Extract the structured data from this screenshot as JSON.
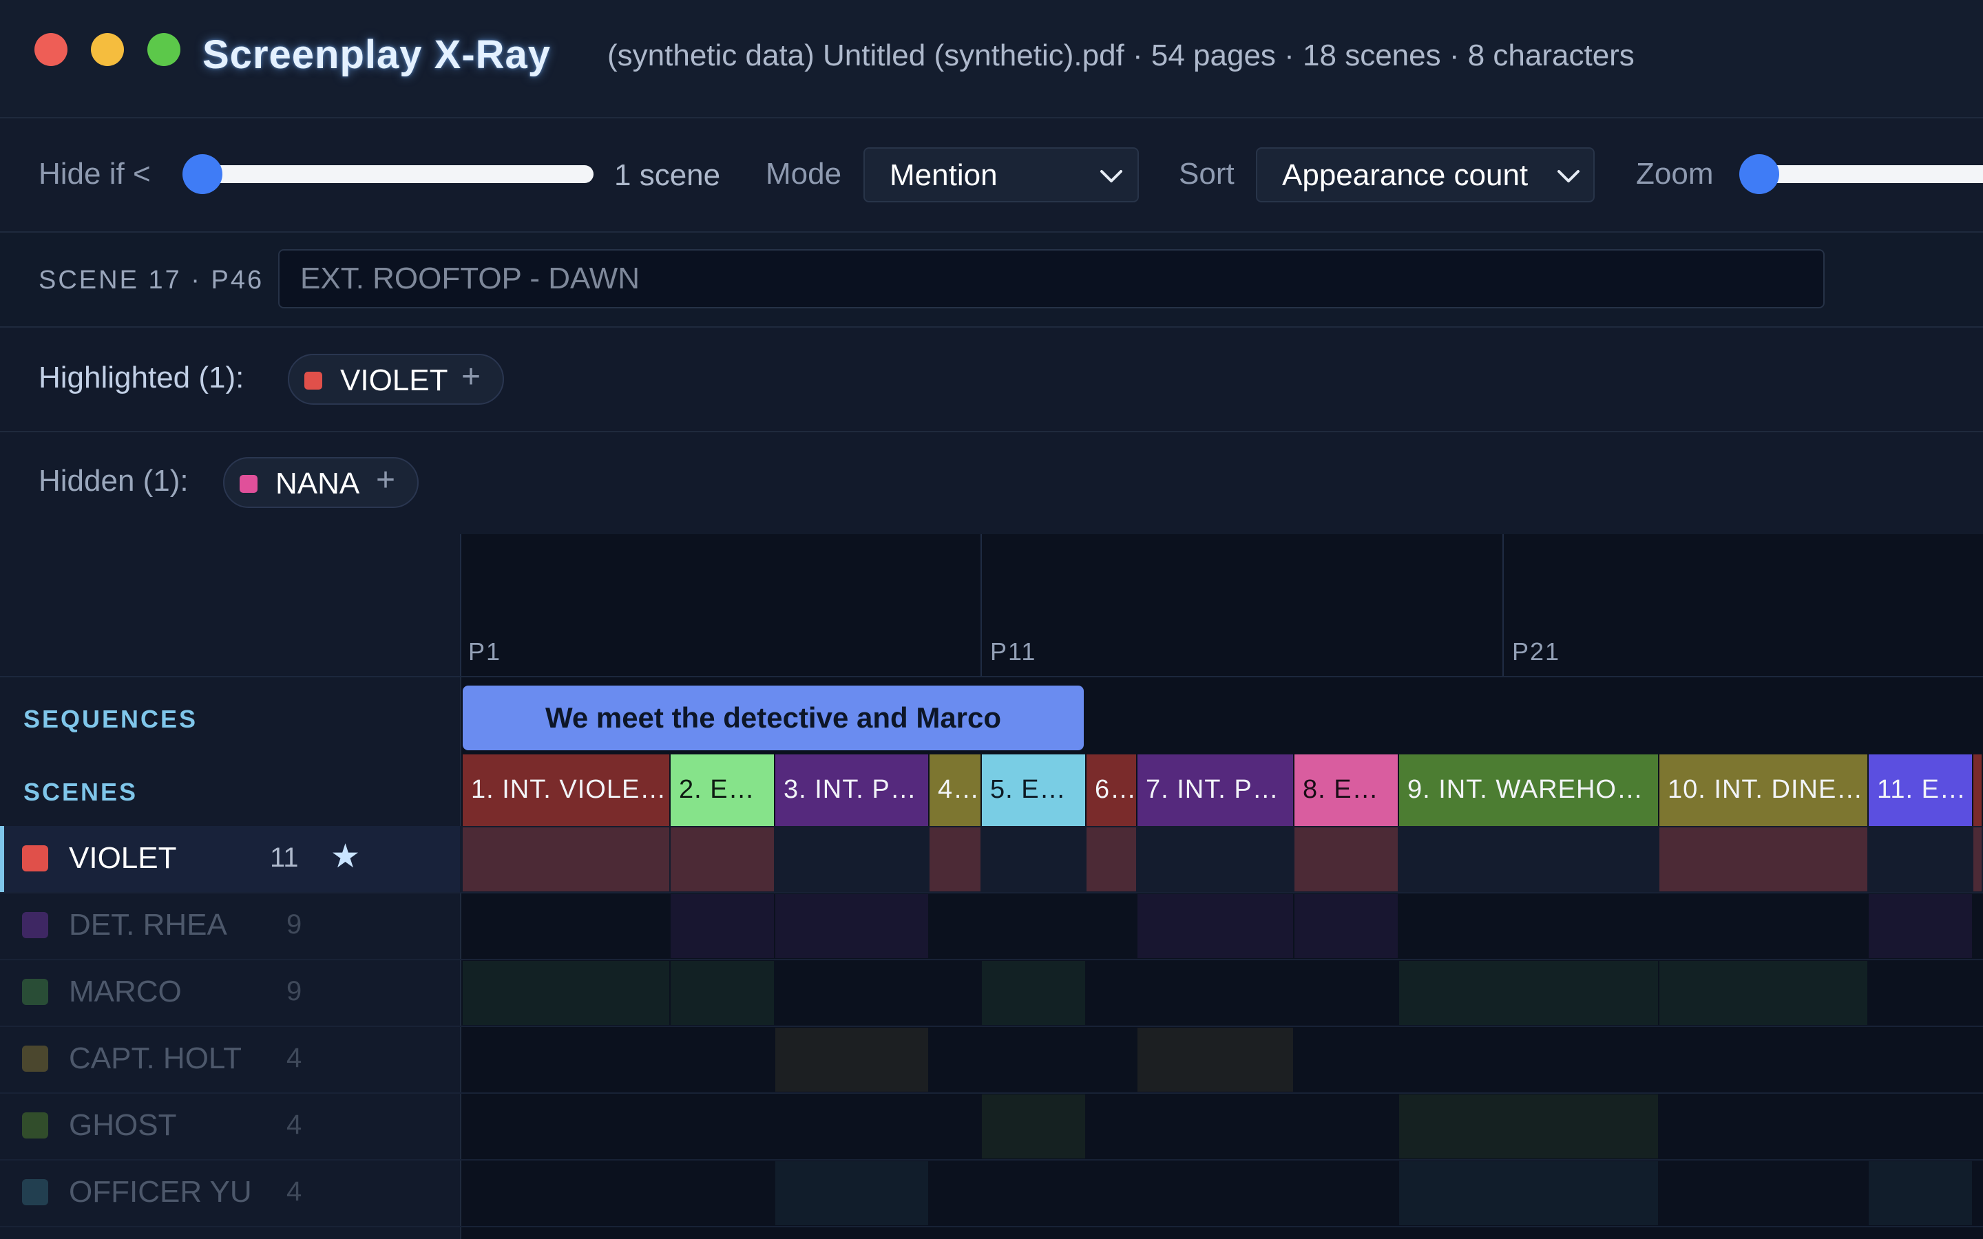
{
  "app": {
    "title": "Screenplay X-Ray",
    "doc_info": "(synthetic data) Untitled (synthetic).pdf · 54 pages · 18 scenes · 8 characters"
  },
  "controls": {
    "hide_label": "Hide if <",
    "hide_value": "1 scene",
    "hide_fraction": 0,
    "mode_label": "Mode",
    "mode_value": "Mention",
    "sort_label": "Sort",
    "sort_value": "Appearance count",
    "zoom_label": "Zoom"
  },
  "scene_bar": {
    "label": "SCENE 17 · P46",
    "placeholder": "EXT. ROOFTOP - DAWN"
  },
  "highlighted": {
    "label": "Highlighted (1):",
    "chips": [
      {
        "name": "VIOLET",
        "color": "#e0504a"
      }
    ]
  },
  "hidden": {
    "label": "Hidden (1):",
    "chips": [
      {
        "name": "NANA",
        "color": "#e0509a"
      }
    ]
  },
  "timeline": {
    "page_labels": [
      "P1",
      "P11",
      "P21"
    ],
    "sequences_label": "SEQUENCES",
    "scenes_label": "SCENES",
    "sequences": [
      {
        "label": "We meet the detective and Marco"
      }
    ],
    "scenes": [
      {
        "label": "1. INT. VIOLE…",
        "color": "#7a2b2b",
        "text_color": "#f2f4f8"
      },
      {
        "label": "2. E…",
        "color": "#86e38a",
        "text_color": "#0e1a12"
      },
      {
        "label": "3. INT. P…",
        "color": "#55297d",
        "text_color": "#f2f4f8"
      },
      {
        "label": "4…",
        "color": "#7d7630",
        "text_color": "#f2f4f8"
      },
      {
        "label": "5. E…",
        "color": "#79cde4",
        "text_color": "#0d1a24"
      },
      {
        "label": "6…",
        "color": "#7a2b2b",
        "text_color": "#f2f4f8"
      },
      {
        "label": "7. INT. P…",
        "color": "#55297d",
        "text_color": "#f2f4f8"
      },
      {
        "label": "8. E…",
        "color": "#d95d9f",
        "text_color": "#1a0d16"
      },
      {
        "label": "9. INT. WAREHO…",
        "color": "#4c7d32",
        "text_color": "#f2f4f8"
      },
      {
        "label": "10. INT. DINE…",
        "color": "#7d7630",
        "text_color": "#f2f4f8"
      },
      {
        "label": "11. E…",
        "color": "#5b4fe0",
        "text_color": "#f2f4f8"
      },
      {
        "label": "",
        "color": "#7a2b2b",
        "text_color": "#f2f4f8"
      }
    ],
    "characters": [
      {
        "name": "VIOLET",
        "count": "11",
        "color": "#e0504a",
        "star": "★",
        "highlighted": true,
        "scenes": [
          0,
          1,
          3,
          5,
          7,
          9,
          11
        ]
      },
      {
        "name": "DET. RHEA",
        "count": "9",
        "color": "#4a2a72",
        "highlighted": false,
        "scenes": [
          1,
          2,
          6,
          7,
          10
        ]
      },
      {
        "name": "MARCO",
        "count": "9",
        "color": "#2f5a3a",
        "highlighted": false,
        "scenes": [
          0,
          1,
          4,
          8,
          9
        ]
      },
      {
        "name": "CAPT. HOLT",
        "count": "4",
        "color": "#5a5330",
        "highlighted": false,
        "scenes": [
          2,
          6
        ]
      },
      {
        "name": "GHOST",
        "count": "4",
        "color": "#3a5a2c",
        "highlighted": false,
        "scenes": [
          4,
          8
        ]
      },
      {
        "name": "OFFICER YU",
        "count": "4",
        "color": "#27495a",
        "highlighted": false,
        "scenes": [
          2,
          8,
          10
        ]
      }
    ]
  }
}
